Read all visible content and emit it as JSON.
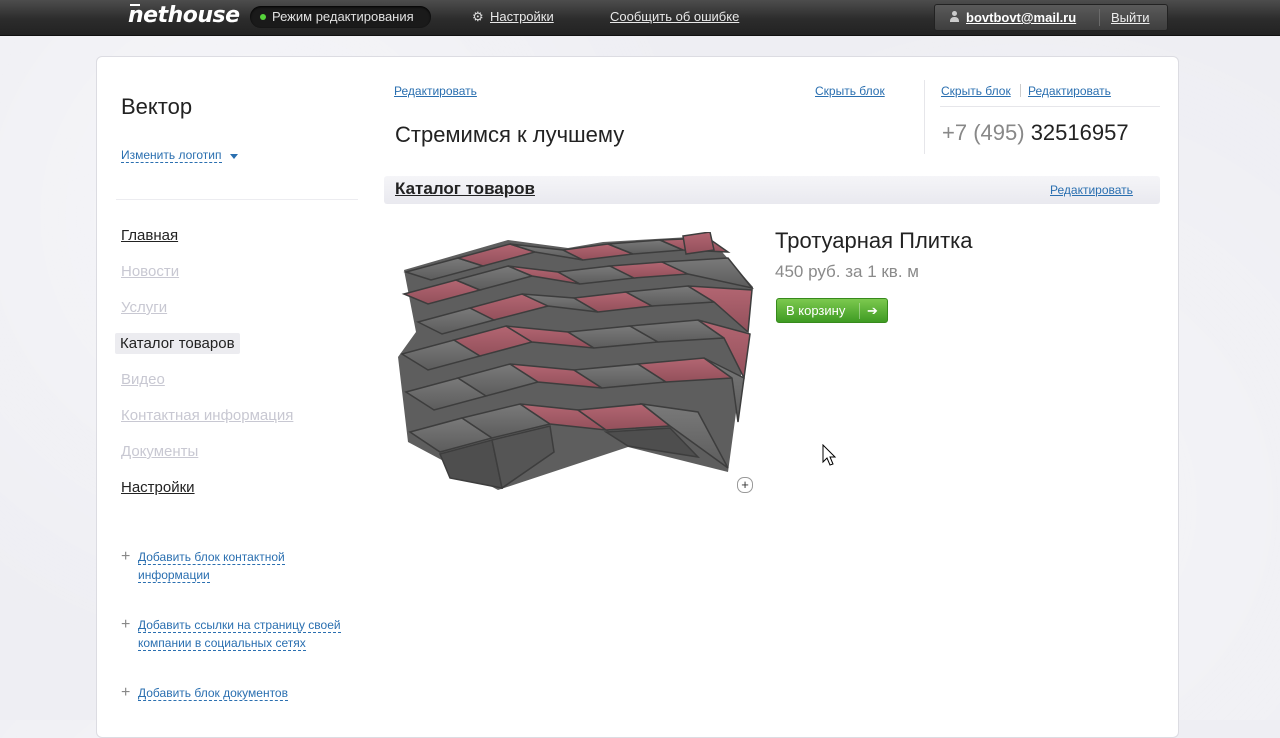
{
  "topbar": {
    "logo": "nethouse",
    "edit_mode": "Режим редактирования",
    "settings": "Настройки",
    "report": "Сообщить об ошибке",
    "user_email": "bovtbovt@mail.ru",
    "logout": "Выйти"
  },
  "sidebar": {
    "site_title": "Вектор",
    "change_logo": "Изменить логотип",
    "nav": [
      {
        "label": "Главная"
      },
      {
        "label": "Новости"
      },
      {
        "label": "Услуги"
      },
      {
        "label": "Каталог товаров"
      },
      {
        "label": "Видео"
      },
      {
        "label": "Контактная информация"
      },
      {
        "label": "Документы"
      },
      {
        "label": "Настройки"
      }
    ],
    "add_blocks": [
      {
        "label": "Добавить блок контактной информации"
      },
      {
        "label": "Добавить ссылки на страницу своей компании в социальных сетях"
      },
      {
        "label": "Добавить блок документов"
      }
    ]
  },
  "header": {
    "edit": "Редактировать",
    "hide": "Скрыть блок",
    "slogan": "Стремимся к лучшему",
    "phone_hide": "Скрыть блок",
    "phone_edit": "Редактировать",
    "phone_prefix": "+7 (495)",
    "phone_number": "32516957"
  },
  "catalog": {
    "title": "Каталог товаров",
    "edit": "Редактировать",
    "product": {
      "name": "Тротуарная Плитка",
      "price": "450 руб. за 1 кв. м",
      "cart_button": "В корзину",
      "add_image": "+"
    }
  },
  "colors": {
    "accent_link": "#2a6fb0",
    "cart_green": "#4aa82b",
    "brick_red": "#a05660",
    "brick_gray": "#6b6b6b"
  }
}
